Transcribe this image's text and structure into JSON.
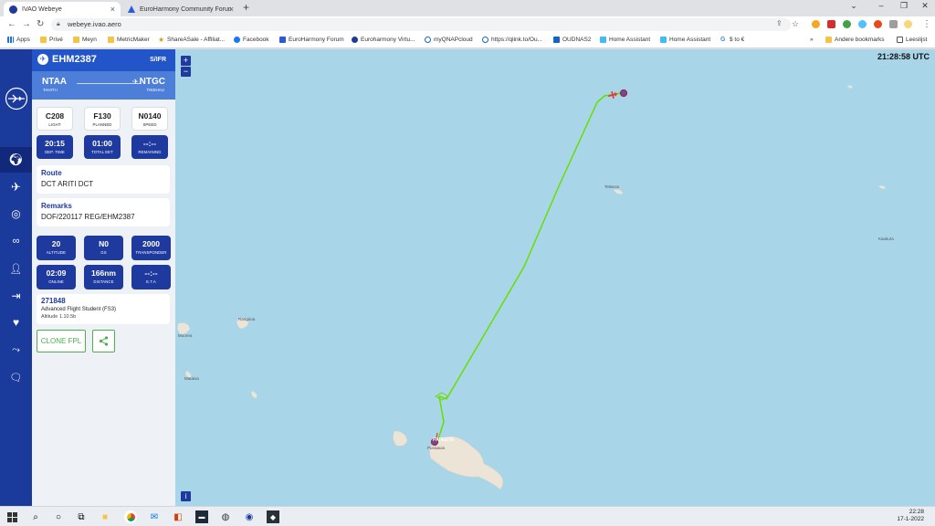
{
  "browser": {
    "tabs": [
      {
        "title": "IVAO Webeye",
        "active": true,
        "favicon_color": "#1e3a9e"
      },
      {
        "title": "EuroHarmony Community Forum",
        "active": false,
        "favicon_color": "#2a5bd7"
      }
    ],
    "url": "webeye.ivao.aero",
    "bookmarks": [
      {
        "label": "Apps",
        "icon": "apps-grid-icon"
      },
      {
        "label": "Privé",
        "icon": "folder-icon"
      },
      {
        "label": "Meyn",
        "icon": "folder-icon"
      },
      {
        "label": "MetricMaker",
        "icon": "folder-icon"
      },
      {
        "label": "ShareASale - Affiliat...",
        "icon": "star-icon"
      },
      {
        "label": "Facebook",
        "icon": "facebook-icon"
      },
      {
        "label": "EuroHarmony Forum",
        "icon": "triangle-icon"
      },
      {
        "label": "Euroharmony Virtu...",
        "icon": "globe-icon"
      },
      {
        "label": "myQNAPcloud",
        "icon": "cloud-icon"
      },
      {
        "label": "https://qlink.to/Ou...",
        "icon": "cloud-icon"
      },
      {
        "label": "OUDNAS2",
        "icon": "nas-icon"
      },
      {
        "label": "Home Assistant",
        "icon": "home-icon"
      },
      {
        "label": "Home Assistant",
        "icon": "home-icon"
      },
      {
        "label": "$ to €",
        "icon": "google-icon"
      }
    ],
    "bookmarks_more": "»",
    "other_bookmarks": "Andere bookmarks",
    "reading_list": "Leeslijst"
  },
  "flight": {
    "callsign": "EHM2387",
    "rules": "S/IFR",
    "departure": {
      "code": "NTAA",
      "name": "TAHITI I"
    },
    "arrival": {
      "code": "NTGC",
      "name": "TIKEHAU"
    },
    "stats_top": [
      {
        "value": "C208",
        "label": "LIGHT"
      },
      {
        "value": "F130",
        "label": "PLANNED"
      },
      {
        "value": "N0140",
        "label": "SPEED"
      }
    ],
    "stats_time": [
      {
        "value": "20:15",
        "label": "DEP. TIME"
      },
      {
        "value": "01:00",
        "label": "TOTAL EET"
      },
      {
        "value": "--:--",
        "label": "REMAINING"
      }
    ],
    "route_title": "Route",
    "route": "DCT ARITI DCT",
    "remarks_title": "Remarks",
    "remarks": "DOF/220117 REG/EHM2387",
    "stats_live": [
      {
        "value": "20",
        "label": "ALTITUDE"
      },
      {
        "value": "N0",
        "label": "GS"
      },
      {
        "value": "2000",
        "label": "TRANSPONDER"
      }
    ],
    "stats_online": [
      {
        "value": "02:09",
        "label": "ONLINE"
      },
      {
        "value": "166nm",
        "label": "DISTANCE"
      },
      {
        "value": "--:--",
        "label": "E.T.A"
      }
    ],
    "pilot_id": "271848",
    "pilot_rating": "Advanced Flight Student (FS3)",
    "pilot_software": "Altitude 1.10.5b",
    "clone_label": "CLONE FPL"
  },
  "map": {
    "clock": "21:28:58 UTC",
    "zoom_in": "+",
    "zoom_out": "−",
    "info": "i",
    "labels": {
      "papeete": "PAPEETE",
      "faaa": "Punaauia",
      "rangiroa": "Rangiroa",
      "moorea": "Moorea",
      "kaukura": "Kaukura",
      "mataiva": "Mataiva",
      "tetiaroa": "Tetiaroa"
    },
    "track_color": "#66e000",
    "plane_color": "#e53935"
  },
  "taskbar": {
    "time": "22:28",
    "date": "17-1-2022"
  }
}
